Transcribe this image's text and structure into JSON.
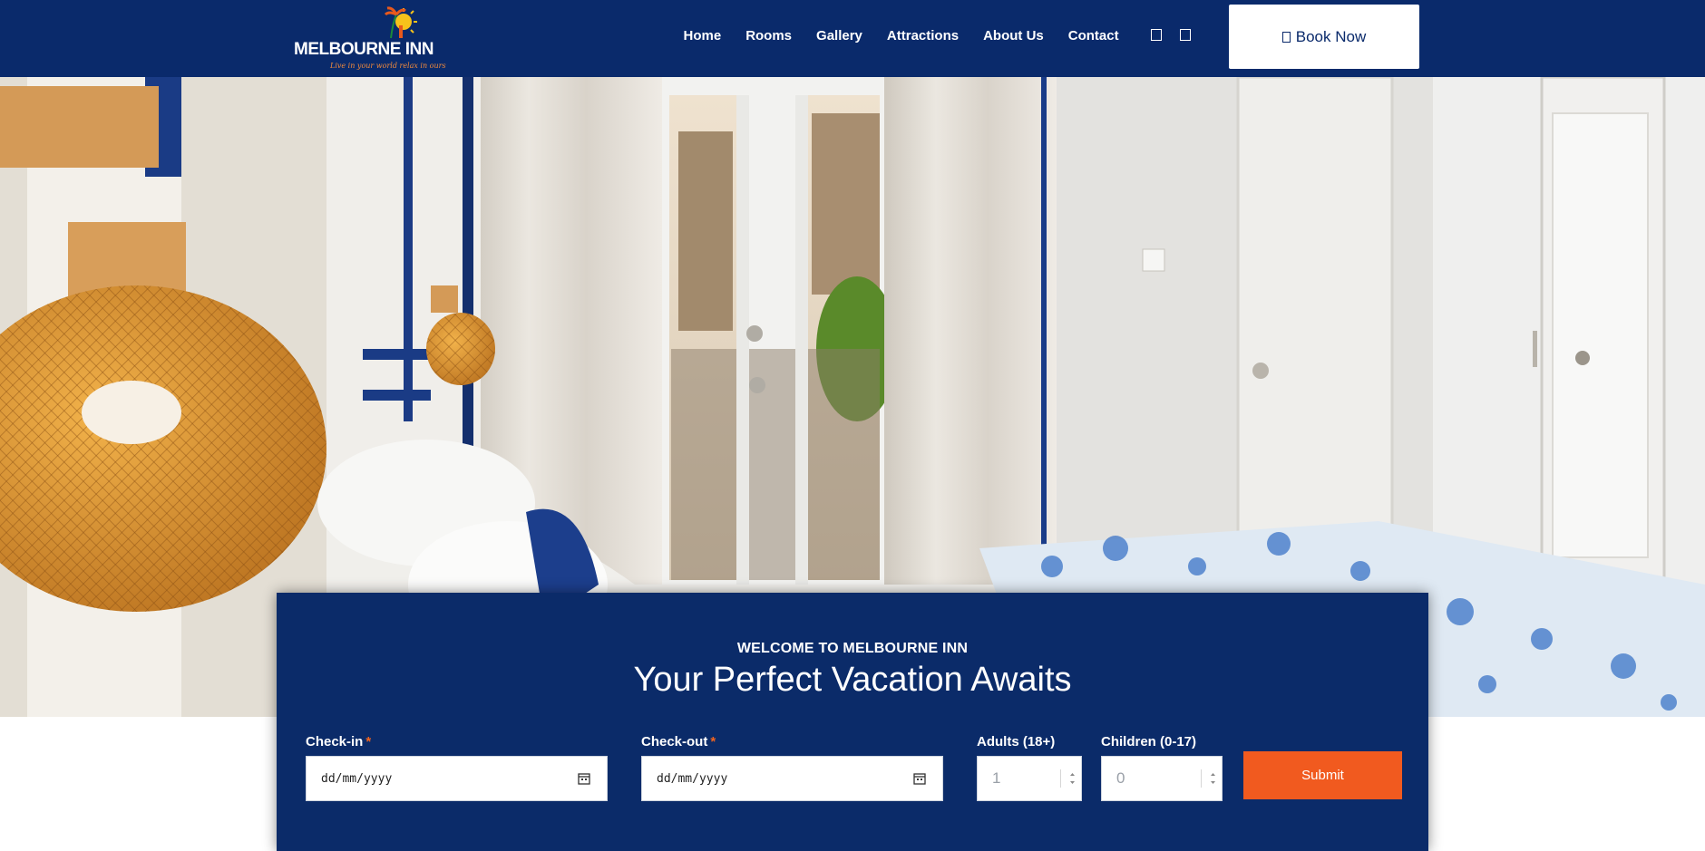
{
  "brand": {
    "name": "MELBOURNE INN",
    "tagline": "Live in your world relax in ours"
  },
  "nav": {
    "items": [
      "Home",
      "Rooms",
      "Gallery",
      "Attractions",
      "About Us",
      "Contact"
    ]
  },
  "social": {
    "icons": [
      "facebook-icon",
      "instagram-icon"
    ]
  },
  "header": {
    "book_label": "Book Now",
    "book_icon": "calendar-icon"
  },
  "booking": {
    "eyebrow": "WELCOME TO MELBOURNE INN",
    "headline": "Your Perfect Vacation Awaits",
    "checkin": {
      "label": "Check-in",
      "required": "*",
      "value": "dd/mm/yyyy"
    },
    "checkout": {
      "label": "Check-out",
      "required": "*",
      "value": "dd/mm/yyyy"
    },
    "adults": {
      "label": "Adults (18+)",
      "value": "1"
    },
    "children": {
      "label": "Children (0-17)",
      "value": "0"
    },
    "submit_label": "Submit"
  },
  "colors": {
    "navy": "#0a2a6b",
    "accent_orange": "#f15a1f",
    "white": "#ffffff"
  }
}
